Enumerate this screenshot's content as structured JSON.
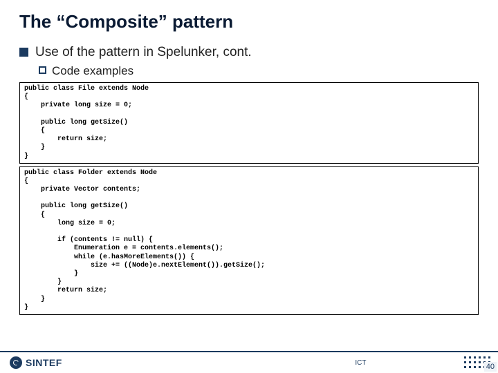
{
  "title": "The “Composite” pattern",
  "bullets": {
    "l1": "Use of the pattern in Spelunker, cont.",
    "l2": "Code examples"
  },
  "code1": "public class File extends Node\n{\n    private long size = 0;\n\n    public long getSize()\n    {\n        return size;\n    }\n}",
  "code2": "public class Folder extends Node\n{\n    private Vector contents;\n\n    public long getSize()\n    {\n        long size = 0;\n\n        if (contents != null) {\n            Enumeration e = contents.elements();\n            while (e.hasMoreElements()) {\n                size += ((Node)e.nextElement()).getSize();\n            }\n        }\n        return size;\n    }\n}",
  "footer": {
    "logo": "SINTEF",
    "mid": "ICT",
    "page": "40"
  }
}
